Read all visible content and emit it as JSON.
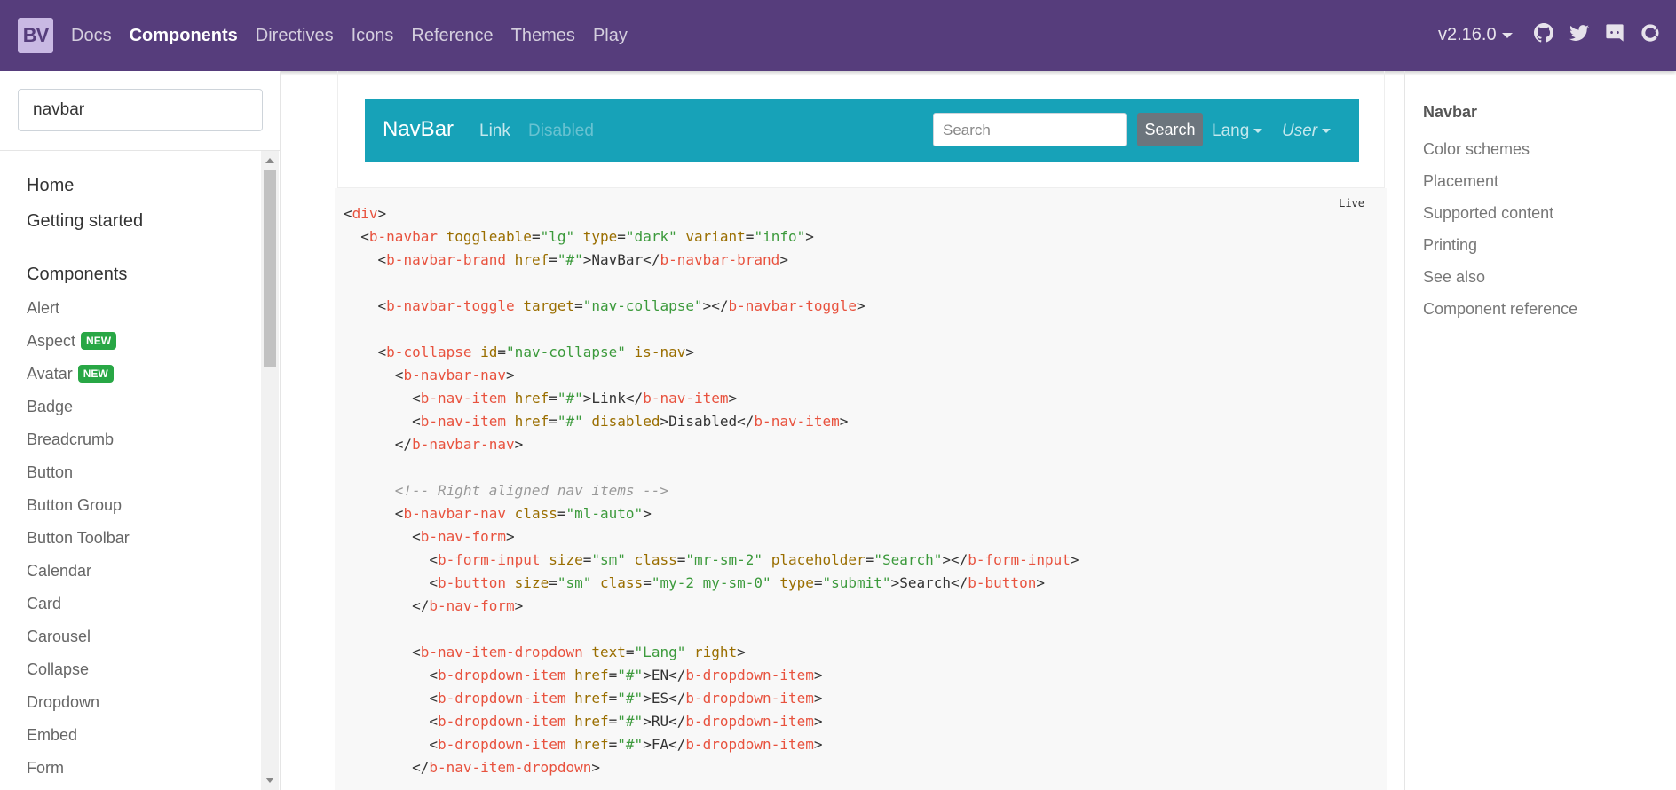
{
  "topbar": {
    "logo": "BV",
    "nav": [
      "Docs",
      "Components",
      "Directives",
      "Icons",
      "Reference",
      "Themes",
      "Play"
    ],
    "active": "Components",
    "version": "v2.16.0",
    "icons": [
      "github-icon",
      "twitter-icon",
      "discord-icon",
      "opencollective-icon"
    ]
  },
  "sidebar": {
    "search_value": "navbar",
    "home": "Home",
    "getting_started": "Getting started",
    "components_heading": "Components",
    "items": [
      {
        "label": "Alert",
        "badge": ""
      },
      {
        "label": "Aspect",
        "badge": "NEW"
      },
      {
        "label": "Avatar",
        "badge": "NEW"
      },
      {
        "label": "Badge",
        "badge": ""
      },
      {
        "label": "Breadcrumb",
        "badge": ""
      },
      {
        "label": "Button",
        "badge": ""
      },
      {
        "label": "Button Group",
        "badge": ""
      },
      {
        "label": "Button Toolbar",
        "badge": ""
      },
      {
        "label": "Calendar",
        "badge": ""
      },
      {
        "label": "Card",
        "badge": ""
      },
      {
        "label": "Carousel",
        "badge": ""
      },
      {
        "label": "Collapse",
        "badge": ""
      },
      {
        "label": "Dropdown",
        "badge": ""
      },
      {
        "label": "Embed",
        "badge": ""
      },
      {
        "label": "Form",
        "badge": ""
      }
    ]
  },
  "demo": {
    "brand": "NavBar",
    "link": "Link",
    "disabled": "Disabled",
    "search_placeholder": "Search",
    "search_button": "Search",
    "lang": "Lang",
    "user": "User"
  },
  "code": {
    "live_label": "Live"
  },
  "toc": {
    "title": "Navbar",
    "items": [
      "Color schemes",
      "Placement",
      "Supported content",
      "Printing",
      "See also",
      "Component reference"
    ]
  }
}
